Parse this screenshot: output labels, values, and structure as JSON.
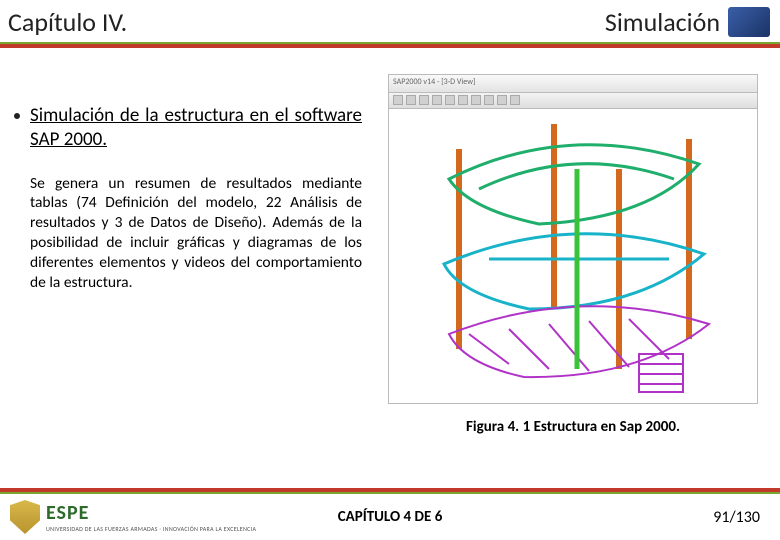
{
  "header": {
    "chapter": "Capítulo IV.",
    "section": "Simulación"
  },
  "body": {
    "subtitle": "Simulación de la estructura en el software SAP 2000.",
    "paragraph": "Se genera un resumen de resultados mediante tablas (74 Definición del modelo, 22 Análisis de resultados y 3 de Datos de Diseño). Además de la posibilidad de incluir gráficas y diagramas de los diferentes elementos y videos del comportamiento de la estructura."
  },
  "figure": {
    "caption": "Figura 4. 1 Estructura en Sap 2000.",
    "window_title": "SAP2000 v14 - [3-D View]"
  },
  "footer": {
    "logo_text": "ESPE",
    "logo_sub": "UNIVERSIDAD DE LAS FUERZAS ARMADAS · INNOVACIÓN PARA LA EXCELENCIA",
    "center": "CAPÍTULO 4 DE 6",
    "page": "91/130"
  }
}
